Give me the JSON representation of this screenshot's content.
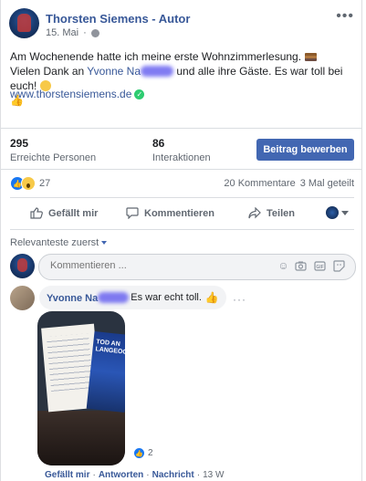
{
  "post": {
    "page_name": "Thorsten Siemens - Autor",
    "date": "15. Mai",
    "text_line1": "Am Wochenende hatte ich meine erste Wohnzimmerlesung.",
    "text_line2_prefix": "Vielen Dank an",
    "mentioned_name": "Yvonne Na",
    "text_line2_suffix": "und alle ihre Gäste. Es war toll bei euch!",
    "url": "www.thorstensiemens.de"
  },
  "stats": {
    "reached_count": "295",
    "reached_label": "Erreichte Personen",
    "interactions_count": "86",
    "interactions_label": "Interaktionen",
    "boost_button": "Beitrag bewerben"
  },
  "engagement": {
    "reaction_count": "27",
    "comments": "20 Kommentare",
    "shares": "3 Mal geteilt"
  },
  "actions": {
    "like": "Gefällt mir",
    "comment": "Kommentieren",
    "share": "Teilen"
  },
  "sort_label": "Relevanteste zuerst",
  "composer": {
    "placeholder": "Kommentieren ..."
  },
  "comment": {
    "author": "Yvonne Na",
    "text": "Es war echt toll.",
    "reaction_count": "2",
    "like_label": "Gefällt mir",
    "reply_label": "Antworten",
    "view_label": "Nachricht",
    "age": "13 W"
  },
  "colors": {
    "link": "#385898",
    "primary_button": "#4267b2",
    "verified": "#2ecc71"
  }
}
